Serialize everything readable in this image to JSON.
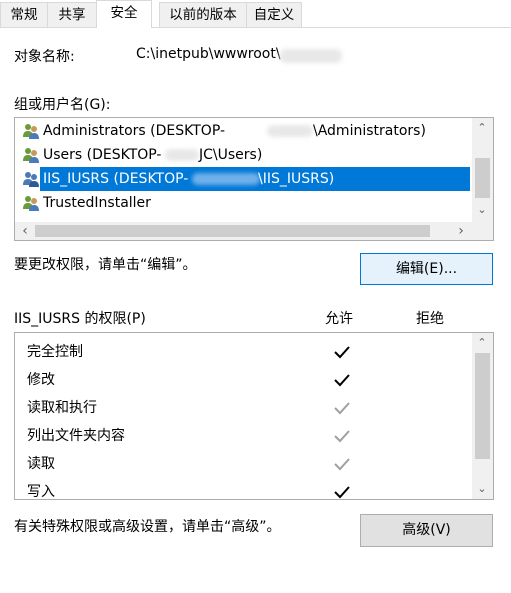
{
  "tabs": [
    {
      "label": "常规"
    },
    {
      "label": "共享"
    },
    {
      "label": "安全"
    },
    {
      "label": "以前的版本"
    },
    {
      "label": "自定义"
    }
  ],
  "object_name": {
    "label": "对象名称:",
    "value": "C:\\inetpub\\wwwroot\\"
  },
  "groups": {
    "label": "组或用户名(G):",
    "items": [
      {
        "name": "Administrators (DESKTOP-",
        "suffix": "\\Administrators)",
        "icon": "users-icon",
        "selected": false
      },
      {
        "name": "Users (DESKTOP-",
        "suffix": "JC\\Users)",
        "icon": "users-icon",
        "selected": false
      },
      {
        "name": "IIS_IUSRS (DESKTOP-",
        "suffix": "\\IIS_IUSRS)",
        "icon": "users-icon",
        "selected": true
      },
      {
        "name": "TrustedInstaller",
        "suffix": "",
        "icon": "users-icon",
        "selected": false
      }
    ]
  },
  "edit": {
    "hint": "要更改权限，请单击“编辑”。",
    "button": "编辑(E)..."
  },
  "permissions": {
    "label": "IIS_IUSRS 的权限(P)",
    "allow_header": "允许",
    "deny_header": "拒绝",
    "items": [
      {
        "name": "完全控制",
        "allow": "explicit",
        "deny": false
      },
      {
        "name": "修改",
        "allow": "explicit",
        "deny": false
      },
      {
        "name": "读取和执行",
        "allow": "inherited",
        "deny": false
      },
      {
        "name": "列出文件夹内容",
        "allow": "inherited",
        "deny": false
      },
      {
        "name": "读取",
        "allow": "inherited",
        "deny": false
      },
      {
        "name": "写入",
        "allow": "explicit",
        "deny": false
      }
    ]
  },
  "advanced": {
    "hint": "有关特殊权限或高级设置，请单击“高级”。",
    "button": "高级(V)"
  },
  "colors": {
    "selection": "#0078d7",
    "check_explicit": "#000000",
    "check_inherited": "#a0a0a0"
  }
}
